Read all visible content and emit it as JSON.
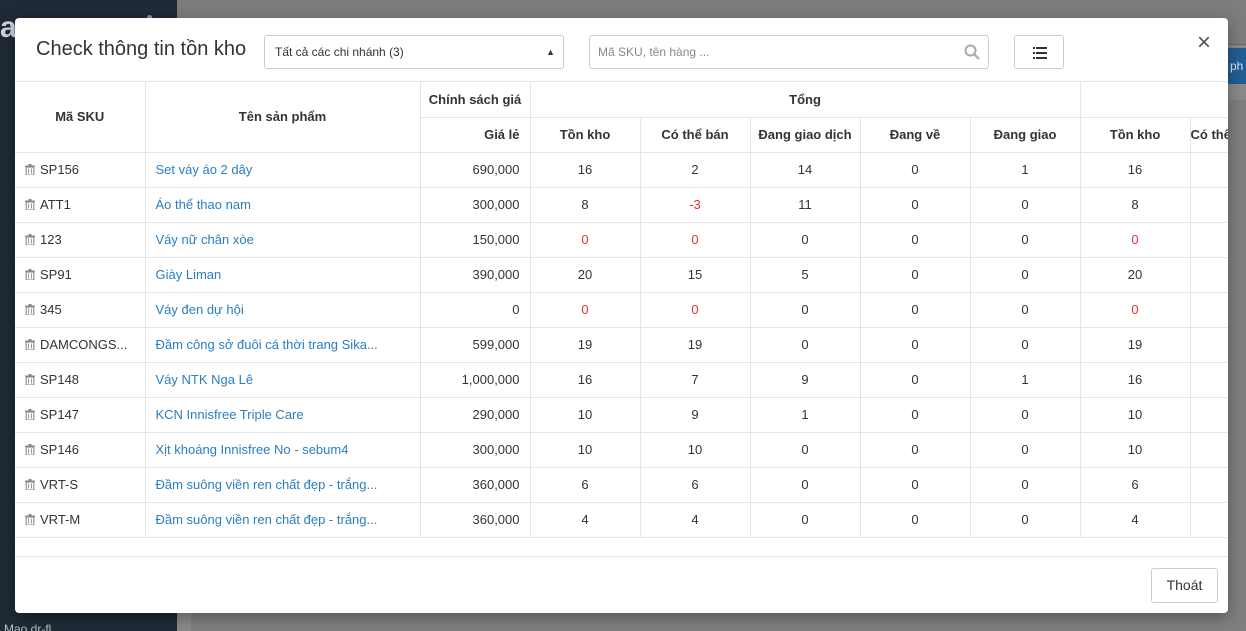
{
  "background": {
    "logo_text": "a",
    "blue_button_text": "ph",
    "bottom_text": "Mạo dr-fl"
  },
  "modal": {
    "title": "Check thông tin tồn kho",
    "branch_select": {
      "selected": "Tất cả các chi nhánh (3)"
    },
    "search": {
      "placeholder": "Mã SKU, tên hàng ...",
      "value": ""
    },
    "close_label": "×",
    "exit_label": "Thoát"
  },
  "table": {
    "headers": {
      "sku": "Mã SKU",
      "name": "Tên sản phẩm",
      "price_policy": "Chính sách giá",
      "total_group": "Tổng",
      "retail_price": "Giá lẻ",
      "stock": "Tồn kho",
      "available": "Có thể bán",
      "in_transaction": "Đang giao dịch",
      "incoming": "Đang về",
      "delivering": "Đang giao",
      "stock2": "Tồn kho",
      "available2": "Có thể bán"
    },
    "rows": [
      {
        "sku": "SP156",
        "name": "Set váy áo 2 dây",
        "price": "690,000",
        "stock": "16",
        "available": "2",
        "in_transaction": "14",
        "incoming": "0",
        "delivering": "1",
        "stock2": "16",
        "available2": ""
      },
      {
        "sku": "ATT1",
        "name": "Áo thể thao nam",
        "price": "300,000",
        "stock": "8",
        "available": "-3",
        "in_transaction": "11",
        "incoming": "0",
        "delivering": "0",
        "stock2": "8",
        "available2": ""
      },
      {
        "sku": "123",
        "name": "Váy nữ chân xòe",
        "price": "150,000",
        "stock": "0",
        "available": "0",
        "in_transaction": "0",
        "incoming": "0",
        "delivering": "0",
        "stock2": "0",
        "available2": ""
      },
      {
        "sku": "SP91",
        "name": "Giày Liman",
        "price": "390,000",
        "stock": "20",
        "available": "15",
        "in_transaction": "5",
        "incoming": "0",
        "delivering": "0",
        "stock2": "20",
        "available2": ""
      },
      {
        "sku": "345",
        "name": "Váy đen dự hội",
        "price": "0",
        "stock": "0",
        "available": "0",
        "in_transaction": "0",
        "incoming": "0",
        "delivering": "0",
        "stock2": "0",
        "available2": ""
      },
      {
        "sku": "DAMCONGS...",
        "name": "Đầm công sở đuôi cá thời trang Sika...",
        "price": "599,000",
        "stock": "19",
        "available": "19",
        "in_transaction": "0",
        "incoming": "0",
        "delivering": "0",
        "stock2": "19",
        "available2": ""
      },
      {
        "sku": "SP148",
        "name": "Váy NTK Nga Lê",
        "price": "1,000,000",
        "stock": "16",
        "available": "7",
        "in_transaction": "9",
        "incoming": "0",
        "delivering": "1",
        "stock2": "16",
        "available2": ""
      },
      {
        "sku": "SP147",
        "name": "KCN Innisfree Triple Care",
        "price": "290,000",
        "stock": "10",
        "available": "9",
        "in_transaction": "1",
        "incoming": "0",
        "delivering": "0",
        "stock2": "10",
        "available2": ""
      },
      {
        "sku": "SP146",
        "name": "Xịt khoáng Innisfree No - sebum4",
        "price": "300,000",
        "stock": "10",
        "available": "10",
        "in_transaction": "0",
        "incoming": "0",
        "delivering": "0",
        "stock2": "10",
        "available2": ""
      },
      {
        "sku": "VRT-S",
        "name": "Đầm suông viền ren chất đẹp - trắng...",
        "price": "360,000",
        "stock": "6",
        "available": "6",
        "in_transaction": "0",
        "incoming": "0",
        "delivering": "0",
        "stock2": "6",
        "available2": ""
      },
      {
        "sku": "VRT-M",
        "name": "Đầm suông viền ren chất đẹp - trắng...",
        "price": "360,000",
        "stock": "4",
        "available": "4",
        "in_transaction": "0",
        "incoming": "0",
        "delivering": "0",
        "stock2": "4",
        "available2": ""
      }
    ]
  },
  "colors": {
    "link": "#2a7ec2",
    "negative": "#e3342f",
    "sidebar": "#1e2a36"
  }
}
